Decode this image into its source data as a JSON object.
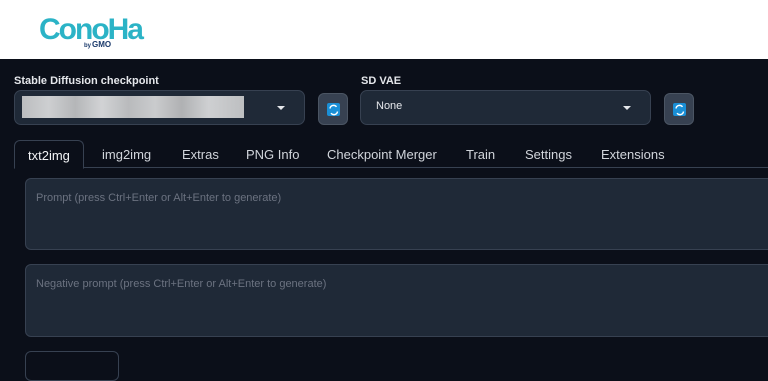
{
  "logo": {
    "text": "ConoHa",
    "subtext": "by GMO"
  },
  "checkpoint": {
    "label": "Stable Diffusion checkpoint",
    "value": "",
    "refresh_icon": "refresh-icon"
  },
  "vae": {
    "label": "SD VAE",
    "value": "None",
    "refresh_icon": "refresh-icon"
  },
  "tabs": [
    {
      "label": "txt2img",
      "active": true
    },
    {
      "label": "img2img"
    },
    {
      "label": "Extras"
    },
    {
      "label": "PNG Info"
    },
    {
      "label": "Checkpoint Merger"
    },
    {
      "label": "Train"
    },
    {
      "label": "Settings"
    },
    {
      "label": "Extensions"
    }
  ],
  "prompt": {
    "placeholder": "Prompt (press Ctrl+Enter or Alt+Enter to generate)"
  },
  "negative_prompt": {
    "placeholder": "Negative prompt (press Ctrl+Enter or Alt+Enter to generate)"
  },
  "colors": {
    "background": "#0b0f19",
    "panel": "#1f2937",
    "border": "#374151",
    "logo": "#2bb3c6",
    "accent": "#1a8fd6"
  }
}
